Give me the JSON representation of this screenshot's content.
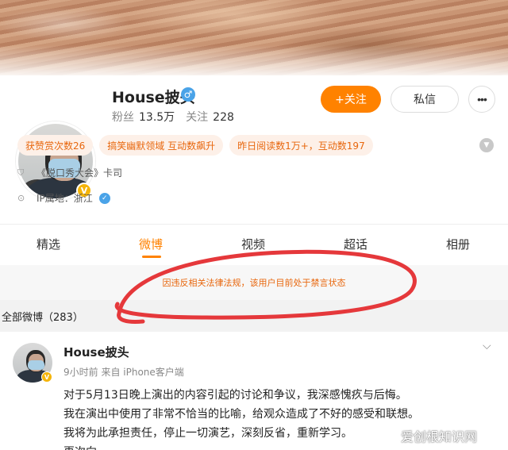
{
  "profile": {
    "name": "House披头",
    "fans_label": "粉丝",
    "fans_value": "13.5万",
    "following_label": "关注",
    "following_value": "228",
    "follow_button": "+关注",
    "message_button": "私信",
    "more_button": "•••",
    "verified_badge": "V",
    "gender_icon": "♂",
    "tags": [
      "获赞赏次数26",
      "搞笑幽默领域 互动数飙升",
      "昨日阅读数1万+，互动数197"
    ],
    "info": [
      {
        "icon": "shield-icon",
        "text": "《脱口秀大会》卡司"
      },
      {
        "icon": "location-icon",
        "text": "IP属地：浙江"
      }
    ]
  },
  "tabs": [
    "精选",
    "微博",
    "视频",
    "超话",
    "相册"
  ],
  "active_tab": "微博",
  "notice": "因违反相关法律法规，该用户目前处于禁言状态",
  "all_posts_label": "全部微博（283）",
  "post": {
    "author": "House披头",
    "meta": "9小时前 来自 iPhone客户端",
    "lines": [
      "对于5月13日晚上演出的内容引起的讨论和争议，我深感愧疚与后悔。",
      "我在演出中使用了非常不恰当的比喻，给观众造成了不好的感受和联想。",
      "我将为此承担责任，停止一切演艺，深刻反省，重新学习。",
      "再次向……"
    ]
  },
  "watermark": "爱创根知识网",
  "colors": {
    "accent": "#ff8200",
    "tag_bg": "#fdf0e8",
    "tag_text": "#e8670e",
    "annotation_red": "#e5383b",
    "verified_gold": "#f5b50a",
    "gender_blue": "#4aa3e8"
  }
}
